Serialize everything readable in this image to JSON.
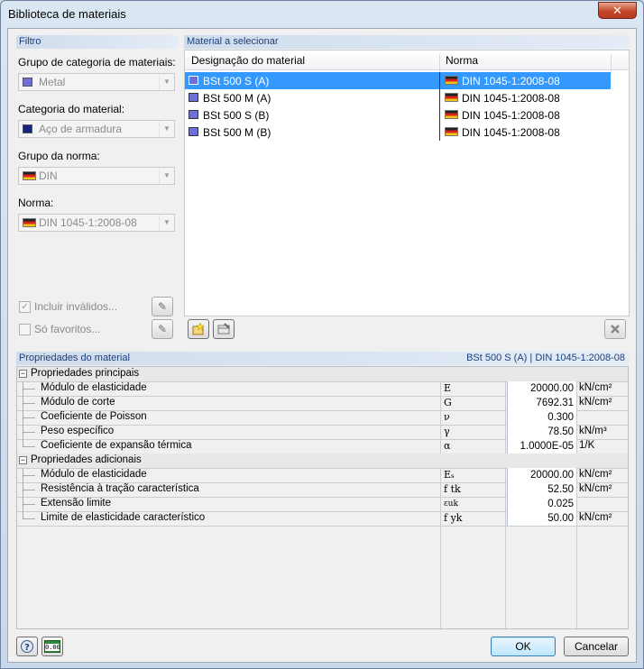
{
  "window": {
    "title": "Biblioteca de materiais",
    "close_glyph": "✕"
  },
  "filter": {
    "header": "Filtro",
    "category_group_label": "Grupo de categoria de materiais:",
    "category_group_value": "Metal",
    "category_label": "Categoria do material:",
    "category_value": "Aço de armadura",
    "standard_group_label": "Grupo da norma:",
    "standard_group_value": "DIN",
    "standard_label": "Norma:",
    "standard_value": "DIN 1045-1:2008-08",
    "include_invalid_label": "Incluir inválidos...",
    "include_invalid_checked": true,
    "favorites_label": "Só favoritos...",
    "favorites_checked": false
  },
  "materials": {
    "header": "Material a selecionar",
    "col_name": "Designação do material",
    "col_standard": "Norma",
    "rows": [
      {
        "name": "BSt 500 S (A)",
        "standard": "DIN 1045-1:2008-08",
        "selected": true
      },
      {
        "name": "BSt 500 M (A)",
        "standard": "DIN 1045-1:2008-08",
        "selected": false
      },
      {
        "name": "BSt 500 S (B)",
        "standard": "DIN 1045-1:2008-08",
        "selected": false
      },
      {
        "name": "BSt 500 M (B)",
        "standard": "DIN 1045-1:2008-08",
        "selected": false
      }
    ]
  },
  "properties": {
    "header": "Propriedades do material",
    "selection": "BSt 500 S (A)  |  DIN 1045-1:2008-08",
    "main_section": "Propriedades principais",
    "main": [
      {
        "name": "Módulo de elasticidade",
        "symbol": "E",
        "value": "20000.00",
        "unit": "kN/cm²"
      },
      {
        "name": "Módulo de corte",
        "symbol": "G",
        "value": "7692.31",
        "unit": "kN/cm²"
      },
      {
        "name": "Coeficiente de Poisson",
        "symbol": "ν",
        "value": "0.300",
        "unit": ""
      },
      {
        "name": "Peso específico",
        "symbol": "γ",
        "value": "78.50",
        "unit": "kN/m³"
      },
      {
        "name": "Coeficiente de expansão térmica",
        "symbol": "α",
        "value": "1.0000E-05",
        "unit": "1/K"
      }
    ],
    "extra_section": "Propriedades adicionais",
    "extra": [
      {
        "name": "Módulo de elasticidade",
        "symbol": "Eₛ",
        "value": "20000.00",
        "unit": "kN/cm²"
      },
      {
        "name": "Resistência à tração característica",
        "symbol": "f tk",
        "value": "52.50",
        "unit": "kN/cm²"
      },
      {
        "name": "Extensão limite",
        "symbol": "εuk",
        "value": "0.025",
        "unit": ""
      },
      {
        "name": "Limite de elasticidade característico",
        "symbol": "f yk",
        "value": "50.00",
        "unit": "kN/cm²"
      }
    ]
  },
  "footer": {
    "ok": "OK",
    "cancel": "Cancelar",
    "units_icon_text": "0.00"
  },
  "colors": {
    "selection": "#3399ff",
    "metal_swatch": "#6f6fd8",
    "steel_swatch": "#1a237e",
    "header_text": "#1c3f7a"
  }
}
